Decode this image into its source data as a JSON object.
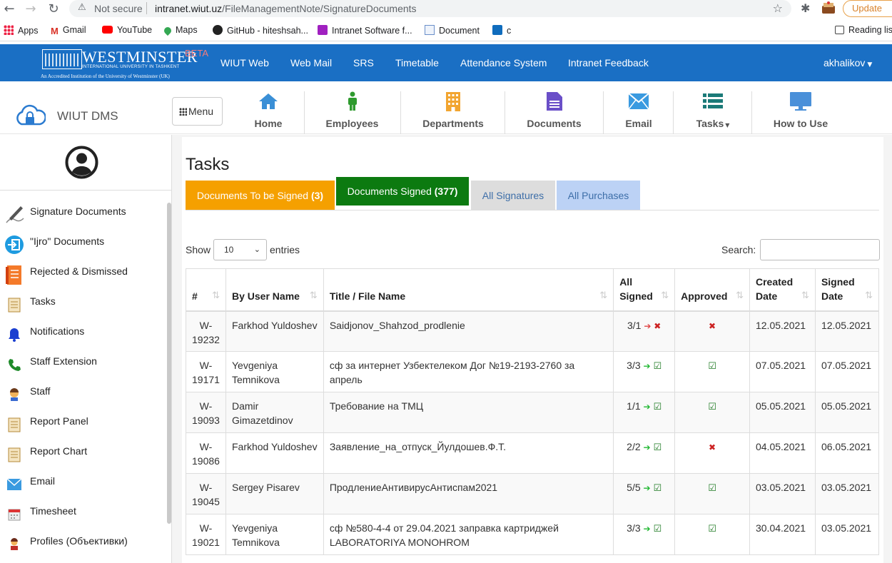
{
  "browser": {
    "not_secure": "Not secure",
    "url_host": "intranet.wiut.uz",
    "url_path": "/FileManagementNote/SignatureDocuments",
    "update_label": "Update",
    "bookmarks": [
      "Apps",
      "Gmail",
      "YouTube",
      "Maps",
      "GitHub - hiteshsah...",
      "Intranet Software f...",
      "Document",
      "c"
    ],
    "reading_list": "Reading lis"
  },
  "header": {
    "logo_name": "WESTMINSTER",
    "logo_beta": "BETA",
    "logo_sub": "INTERNATIONAL UNIVERSITY IN TASHKENT",
    "logo_accredited": "An Accredited Institution of the University of Westminster (UK)",
    "links": [
      "WIUT Web",
      "Web Mail",
      "SRS",
      "Timetable",
      "Attendance System",
      "Intranet Feedback"
    ],
    "user": "akhalikov"
  },
  "subnav": {
    "app_title": "WIUT DMS",
    "menu_label": "Menu",
    "items": [
      "Home",
      "Employees",
      "Departments",
      "Documents",
      "Email",
      "Tasks",
      "How to Use"
    ]
  },
  "sidebar": {
    "items": [
      "Signature Documents",
      "\"Ijro\" Documents",
      "Rejected & Dismissed",
      "Tasks",
      "Notifications",
      "Staff Extension",
      "Staff",
      "Report Panel",
      "Report Chart",
      "Email",
      "Timesheet",
      "Profiles (Объективки)"
    ]
  },
  "main": {
    "title": "Tasks",
    "tabs": [
      {
        "label": "Documents To be Signed",
        "count": "(3)"
      },
      {
        "label": "Documents Signed",
        "count": "(377)"
      },
      {
        "label": "All Signatures",
        "count": ""
      },
      {
        "label": "All Purchases",
        "count": ""
      }
    ],
    "show_label": "Show",
    "show_value": "10",
    "entries_label": "entries",
    "search_label": "Search:"
  },
  "table": {
    "headers": [
      "#",
      "By User Name",
      "Title / File Name",
      "All Signed",
      "Approved",
      "Created Date",
      "Signed Date"
    ],
    "rows": [
      {
        "id": "W-19232",
        "user": "Farkhod Yuldoshev",
        "title": "Saidjonov_Shahzod_prodlenie",
        "signed": "3/1",
        "signed_ok": false,
        "approved": false,
        "created": "12.05.2021",
        "signed_date": "12.05.2021"
      },
      {
        "id": "W-19171",
        "user": "Yevgeniya Temnikova",
        "title": "сф за интернет Узбектелеком Дог №19-2193-2760 за апрель",
        "signed": "3/3",
        "signed_ok": true,
        "approved": true,
        "created": "07.05.2021",
        "signed_date": "07.05.2021"
      },
      {
        "id": "W-19093",
        "user": "Damir Gimazetdinov",
        "title": "Требование на ТМЦ",
        "signed": "1/1",
        "signed_ok": true,
        "approved": true,
        "created": "05.05.2021",
        "signed_date": "05.05.2021"
      },
      {
        "id": "W-19086",
        "user": "Farkhod Yuldoshev",
        "title": "Заявление_на_отпуск_Йулдошев.Ф.Т.",
        "signed": "2/2",
        "signed_ok": true,
        "approved": false,
        "created": "04.05.2021",
        "signed_date": "06.05.2021"
      },
      {
        "id": "W-19045",
        "user": "Sergey Pisarev",
        "title": "ПродлениеАнтивирусАнтиспам2021",
        "signed": "5/5",
        "signed_ok": true,
        "approved": true,
        "created": "03.05.2021",
        "signed_date": "03.05.2021"
      },
      {
        "id": "W-19021",
        "user": "Yevgeniya Temnikova",
        "title": "сф №580-4-4 от 29.04.2021 заправка картриджей LABORATORIYA MONOHROM",
        "signed": "3/3",
        "signed_ok": true,
        "approved": true,
        "created": "30.04.2021",
        "signed_date": "03.05.2021"
      }
    ]
  }
}
